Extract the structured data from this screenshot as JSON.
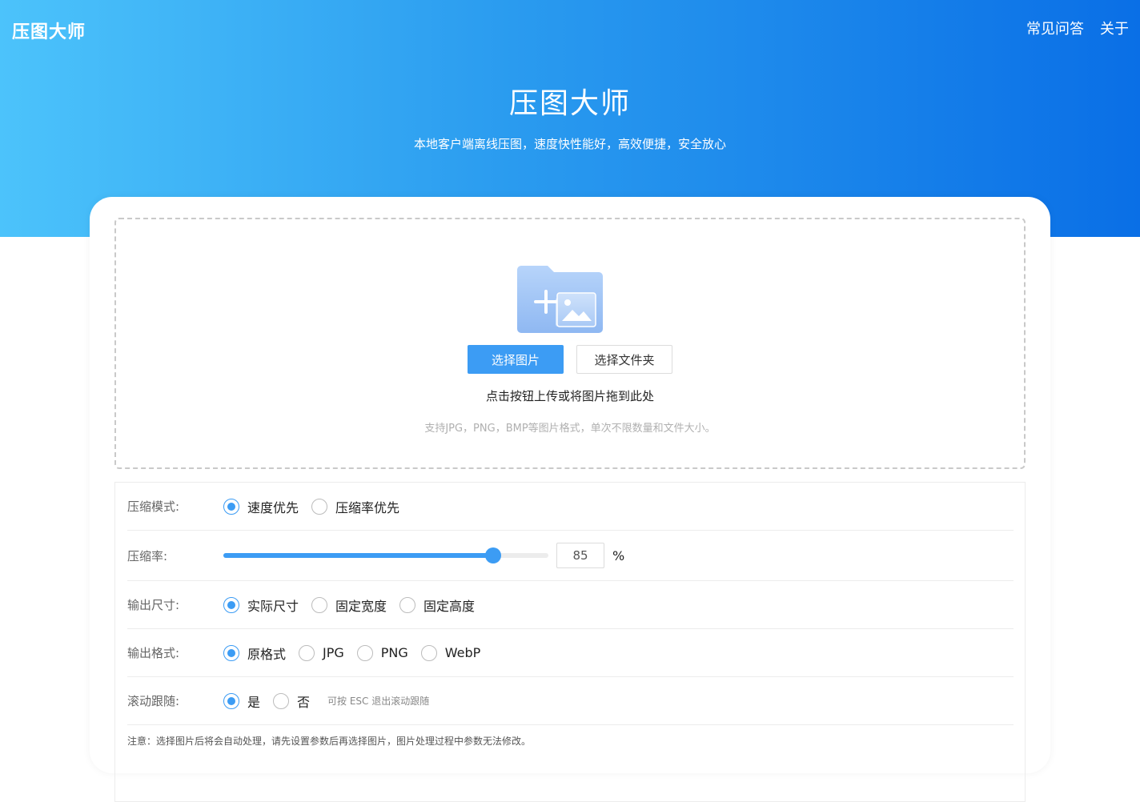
{
  "header": {
    "logo": "压图大师",
    "nav": [
      "常见问答",
      "关于"
    ],
    "title": "压图大师",
    "subtitle": "本地客户端离线压图，速度快性能好，高效便捷，安全放心"
  },
  "upload": {
    "select_images": "选择图片",
    "select_folder": "选择文件夹",
    "hint": "点击按钮上传或将图片拖到此处",
    "note": "支持JPG，PNG，BMP等图片格式，单次不限数量和文件大小。"
  },
  "settings": {
    "mode": {
      "label": "压缩模式:",
      "options": [
        "速度优先",
        "压缩率优先"
      ],
      "selected": 0
    },
    "rate": {
      "label": "压缩率:",
      "value": "85",
      "unit": "%",
      "fraction": 0.83
    },
    "size": {
      "label": "输出尺寸:",
      "options": [
        "实际尺寸",
        "固定宽度",
        "固定高度"
      ],
      "selected": 0
    },
    "format": {
      "label": "输出格式:",
      "options": [
        "原格式",
        "JPG",
        "PNG",
        "WebP"
      ],
      "selected": 0
    },
    "scroll": {
      "label": "滚动跟随:",
      "options": [
        "是",
        "否"
      ],
      "selected": 0,
      "hint": "可按 ESC 退出滚动跟随"
    },
    "footnote": "注意：选择图片后将会自动处理，请先设置参数后再选择图片，图片处理过程中参数无法修改。"
  },
  "colors": {
    "accent": "#3c9cf4",
    "gradient_start": "#4cc3fb",
    "gradient_end": "#0a6fe6"
  }
}
